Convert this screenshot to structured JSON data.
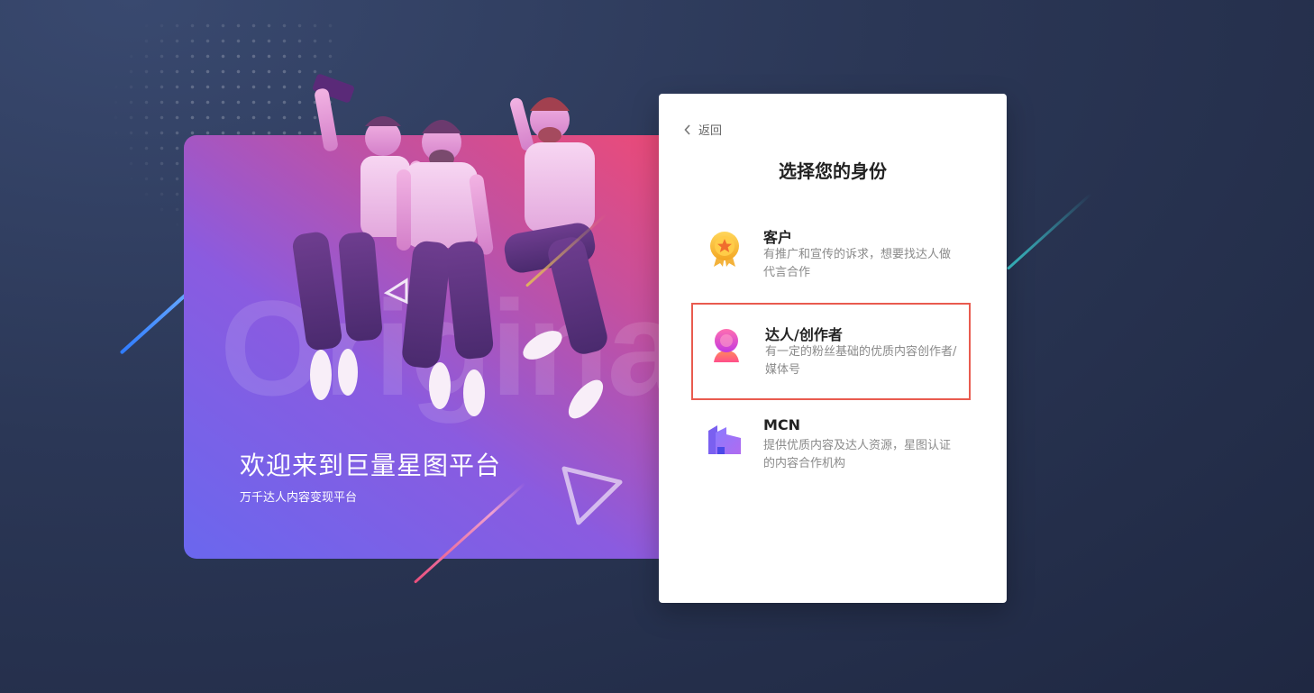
{
  "banner": {
    "watermark": "Originality",
    "title": "欢迎来到巨量星图平台",
    "subtitle": "万千达人内容变现平台"
  },
  "panel": {
    "back_label": "返回",
    "title": "选择您的身份",
    "options": [
      {
        "name": "客户",
        "desc": "有推广和宣传的诉求，想要找达人做代言合作",
        "icon": "medal-icon",
        "selected": false
      },
      {
        "name": "达人/创作者",
        "desc": "有一定的粉丝基础的优质内容创作者/媒体号",
        "icon": "creator-avatar-icon",
        "selected": true
      },
      {
        "name": "MCN",
        "desc": "提供优质内容及达人资源，星图认证的内容合作机构",
        "icon": "building-icon",
        "selected": false
      }
    ]
  },
  "colors": {
    "selected_border": "#e95b4f",
    "banner_gradient": [
      "#6a67ee",
      "#c4509f",
      "#ef4a74"
    ]
  }
}
